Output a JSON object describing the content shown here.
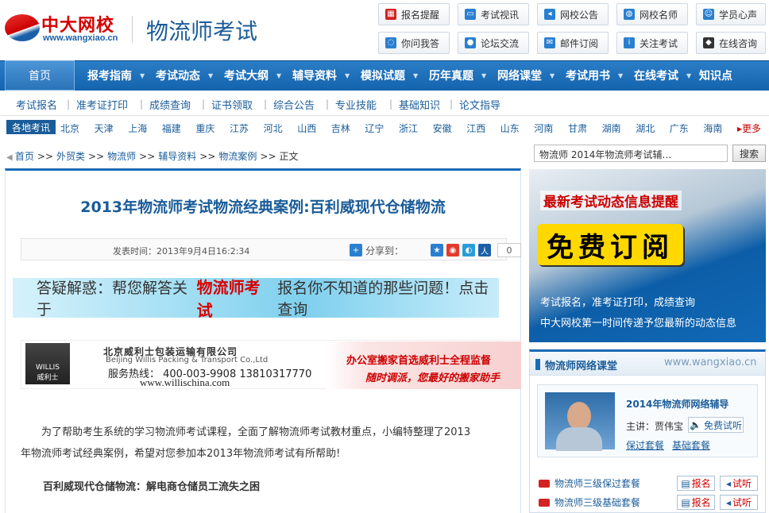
{
  "header": {
    "logo_text": "中大网校",
    "logo_url": "www.wangxiao.cn",
    "site_title": "物流师考试",
    "top_buttons": [
      {
        "label": "报名提醒",
        "icon": "calendar-icon",
        "color": "#d42222"
      },
      {
        "label": "考试视讯",
        "icon": "monitor-icon",
        "color": "#2a7fd0"
      },
      {
        "label": "网校公告",
        "icon": "speaker-icon",
        "color": "#2a7fd0"
      },
      {
        "label": "网校名师",
        "icon": "globe-icon",
        "color": "#2a7fd0"
      },
      {
        "label": "学员心声",
        "icon": "smile-icon",
        "color": "#2a7fd0"
      },
      {
        "label": "你问我答",
        "icon": "chat-bubble-icon",
        "color": "#2a7fd0"
      },
      {
        "label": "论坛交流",
        "icon": "people-icon",
        "color": "#2a7fd0"
      },
      {
        "label": "邮件订阅",
        "icon": "mail-icon",
        "color": "#2a7fd0"
      },
      {
        "label": "关注考试",
        "icon": "info-icon",
        "color": "#2a7fd0"
      },
      {
        "label": "在线咨询",
        "icon": "qq-penguin-icon",
        "color": "#333333"
      }
    ]
  },
  "nav": {
    "home": "首页",
    "items": [
      "报考指南",
      "考试动态",
      "考试大纲",
      "辅导资料",
      "模拟试题",
      "历年真题",
      "网络课堂",
      "考试用书",
      "在线考试",
      "知识点"
    ]
  },
  "subnav": [
    "考试报名",
    "准考证打印",
    "成绩查询",
    "证书领取",
    "综合公告",
    "专业技能",
    "基础知识",
    "论文指导"
  ],
  "cities": {
    "tag": "各地考讯",
    "list": [
      "北京",
      "天津",
      "上海",
      "福建",
      "重庆",
      "江苏",
      "河北",
      "山西",
      "吉林",
      "辽宁",
      "浙江",
      "安徽",
      "江西",
      "山东",
      "河南",
      "甘肃",
      "湖南",
      "湖北",
      "广东",
      "海南"
    ],
    "more": "更多"
  },
  "breadcrumb": {
    "items": [
      "首页",
      "外贸类",
      "物流师",
      "辅导资料",
      "物流案例"
    ],
    "current": "正文",
    "sep": ">>"
  },
  "search": {
    "value": "物流师  2014年物流师考试辅…",
    "button": "搜索"
  },
  "article": {
    "title": "2013年物流师考试物流经典案例:百利威现代仓储物流",
    "time": "发表时间：2013年9月4日16:2:34",
    "share_label": "分享到：",
    "share_count": "0",
    "banner": {
      "prefix": "答疑解惑：帮您解答关于",
      "highlight": "物流师考试",
      "suffix": "报名你不知道的那些问题！点击查询"
    },
    "ad": {
      "company": "北京威利士包装运输有限公司",
      "company_en": "Beijing Willis Packing & Transport Co.,Ltd",
      "hotline": "服务热线：  400-003-9908 13810317770",
      "url": "www.willischina.com",
      "logo": "WILLIS",
      "logo_cn": "威利士",
      "slogan1": "办公室搬家首选威利士全程监督",
      "slogan2": "随时调派，您最好的搬家助手"
    },
    "para1_line1": "为了帮助考生系统的学习物流师考试课程，全面了解物流师考试教材重点，小编特整理了2013",
    "para1_line2": "年物流师考试经典案例，希望对您参加本2013年物流师考试有所帮助!",
    "subheading": "百利威现代仓储物流：解电商仓储员工流失之困"
  },
  "sidebar": {
    "ad": {
      "title": "最新考试动态信息提醒",
      "button": "免费订阅",
      "line1": "考试报名，准考证打印，成绩查询",
      "line2": "中大网校第一时间传递予您最新的动态信息"
    },
    "course": {
      "title": "物流师网络课堂",
      "url": "www.wangxiao.cn",
      "featured_title": "2014年物流师网络辅导",
      "lecturer": "主讲：贾伟宝",
      "trial": "免费试听",
      "link1": "保过套餐",
      "link2": "基础套餐",
      "rows": [
        {
          "name": "物流师三级保过套餐",
          "signup": "报名",
          "trial": "试听"
        },
        {
          "name": "物流师三级基础套餐",
          "signup": "报名",
          "trial": "试听"
        }
      ]
    }
  }
}
